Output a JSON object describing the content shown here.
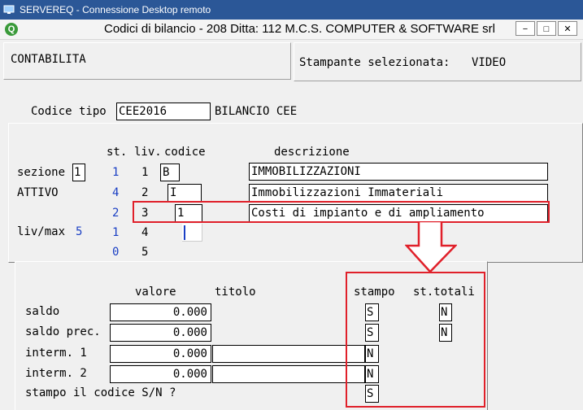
{
  "rdp_title": "SERVEREQ - Connessione Desktop remoto",
  "app_title": "Codici di bilancio - 208    Ditta: 112  M.C.S. COMPUTER & SOFTWARE srl",
  "window_buttons": {
    "minimize": "−",
    "maximize": "□",
    "close": "✕"
  },
  "module": "CONTABILITA",
  "printer": {
    "label": "Stampante selezionata:",
    "value": "VIDEO"
  },
  "codice_tipo": {
    "label": "Codice tipo",
    "value": "CEE2016",
    "desc": "BILANCIO CEE"
  },
  "grid_headers": {
    "st": "st.",
    "liv": "liv.",
    "codice": "codice",
    "descrizione": "descrizione"
  },
  "sezione": {
    "label": "sezione",
    "value": "1"
  },
  "attivo_label": "ATTIVO",
  "livmax": {
    "label": "liv/max",
    "value": "5"
  },
  "rows": [
    {
      "st": "1",
      "liv": "1",
      "codice": "B",
      "descrizione": "IMMOBILIZZAZIONI"
    },
    {
      "st": "4",
      "liv": "2",
      "codice": "I",
      "descrizione": "Immobilizzazioni Immateriali"
    },
    {
      "st": "2",
      "liv": "3",
      "codice": "1",
      "descrizione": "Costi di impianto e di ampliamento"
    },
    {
      "st": "1",
      "liv": "4",
      "codice": "",
      "descrizione": ""
    },
    {
      "st": "0",
      "liv": "5",
      "codice": "",
      "descrizione": ""
    }
  ],
  "bottom_headers": {
    "valore": "valore",
    "titolo": "titolo",
    "stampo": "stampo",
    "st_totali": "st.totali"
  },
  "bottom_rows": [
    {
      "label": "saldo",
      "valore": "0.000",
      "titolo": "",
      "stampo": "S",
      "st_totali": "N"
    },
    {
      "label": "saldo prec.",
      "valore": "0.000",
      "titolo": "",
      "stampo": "S",
      "st_totali": "N"
    },
    {
      "label": "interm. 1",
      "valore": "0.000",
      "titolo": "",
      "stampo": "N",
      "st_totali": ""
    },
    {
      "label": "interm. 2",
      "valore": "0.000",
      "titolo": "",
      "stampo": "N",
      "st_totali": ""
    }
  ],
  "stampo_codice": {
    "label": "stampo il codice S/N ?",
    "value": "S"
  },
  "colors": {
    "titlebar": "#2b5797",
    "annotation": "#e0202a",
    "blue_text": "#1a3fc4"
  }
}
